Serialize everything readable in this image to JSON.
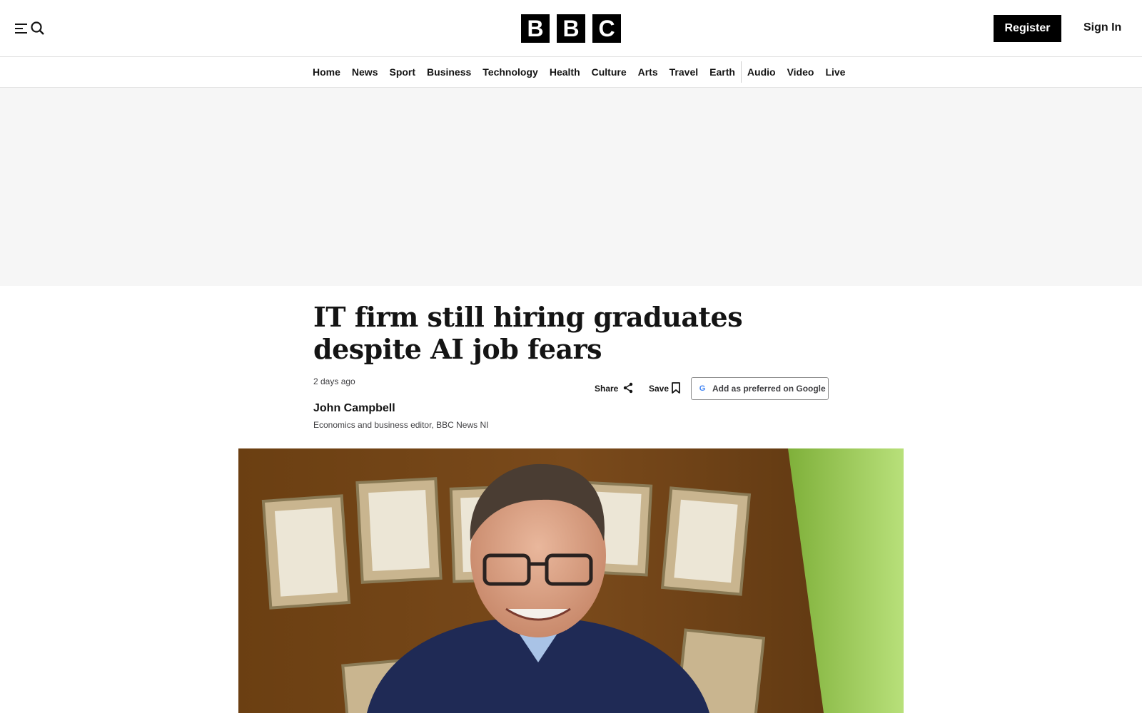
{
  "header": {
    "logo_letters": [
      "B",
      "B",
      "C"
    ],
    "menu_icon": "hamburger-icon",
    "search_icon": "search-icon",
    "register_label": "Register",
    "signin_label": "Sign In"
  },
  "nav": {
    "items": [
      {
        "label": "Home"
      },
      {
        "label": "News"
      },
      {
        "label": "Sport"
      },
      {
        "label": "Business"
      },
      {
        "label": "Technology"
      },
      {
        "label": "Health"
      },
      {
        "label": "Culture"
      },
      {
        "label": "Arts"
      },
      {
        "label": "Travel"
      },
      {
        "label": "Earth"
      },
      {
        "label": "Audio"
      },
      {
        "label": "Video"
      },
      {
        "label": "Live"
      }
    ]
  },
  "article": {
    "headline": "IT firm still hiring graduates despite AI job fears",
    "timestamp": "2 days ago",
    "author_name": "John Campbell",
    "author_role": "Economics and business editor, BBC News NI",
    "share_label": "Share",
    "share_icon": "share-icon",
    "save_label": "Save",
    "save_icon": "bookmark-icon",
    "google_label": "Add as preferred on Google",
    "google_icon": "google-g-icon",
    "google_letter": "G"
  },
  "colors": {
    "header_bg": "#ffffff",
    "ad_band_bg": "#f6f6f6",
    "logo_block": "#000000",
    "register_bg": "#000000",
    "text_primary": "#141414",
    "text_secondary": "#3f3f42"
  }
}
